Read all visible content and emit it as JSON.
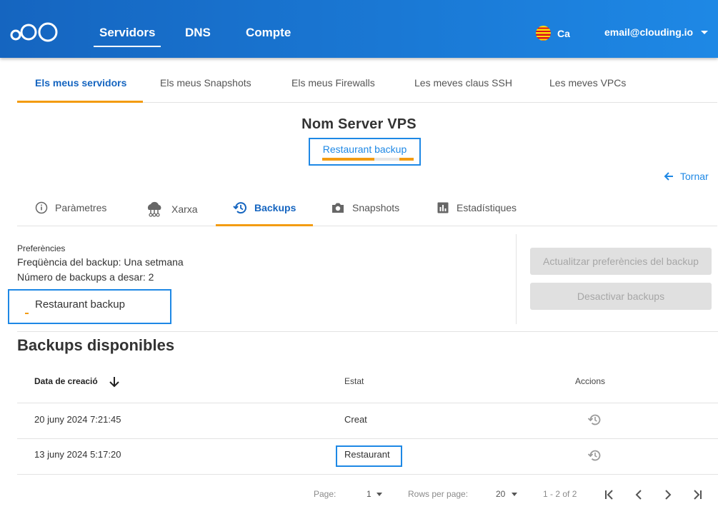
{
  "topbar": {
    "nav": [
      "Servidors",
      "DNS",
      "Compte"
    ],
    "language": "Ca",
    "user_email": "email@clouding.io"
  },
  "subnav": [
    "Els meus servidors",
    "Els meus Snapshots",
    "Els meus Firewalls",
    "Les meves claus SSH",
    "Les meves VPCs"
  ],
  "server": {
    "name": "Nom Server VPS",
    "status": "Restaurant backup",
    "progress": 0.57
  },
  "back_label": "Tornar",
  "tabs": [
    "Paràmetres",
    "Xarxa",
    "Backups",
    "Snapshots",
    "Estadístiques"
  ],
  "preferences": {
    "title": "Preferències",
    "frequency": "Freqüència del backup: Una setmana",
    "count": "Número de backups a desar: 2",
    "status": "Restaurant backup",
    "update_button": "Actualitzar preferències del backup",
    "disable_button": "Desactivar backups"
  },
  "backups": {
    "title": "Backups disponibles",
    "columns": [
      "Data de creació",
      "Estat",
      "Accions"
    ],
    "rows": [
      {
        "date": "20 juny 2024 7:21:45",
        "status": "Creat"
      },
      {
        "date": "13 juny 2024 5:17:20",
        "status": "Restaurant"
      }
    ]
  },
  "pagination": {
    "page_label": "Page:",
    "page": "1",
    "rows_label": "Rows per page:",
    "rows": "20",
    "range": "1 - 2 of 2"
  },
  "colors": {
    "topbar_start": "#1565c0",
    "topbar_end": "#1e88e5",
    "accent": "#f39c12",
    "link": "#1e88e5",
    "highlight_border": "#1e88e5"
  }
}
